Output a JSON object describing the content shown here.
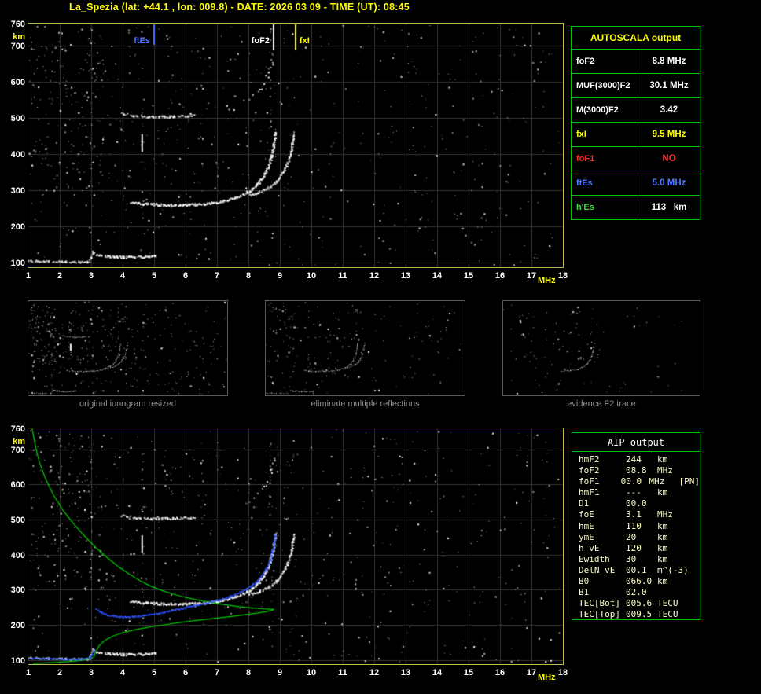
{
  "title": "La_Spezia (lat: +44.1 , lon: 009.8) - DATE: 2026 03 09 - TIME (UT): 08:45",
  "colors": {
    "yellow": "#ffff00",
    "white": "#ffffff",
    "green": "#00c400",
    "blue": "#4d79ff",
    "red": "#ff2828",
    "grid": "#333333",
    "plot_border": "#b9b94f",
    "thumb_border": "#5a5a5a",
    "caption": "#909090",
    "aip_text": "#ffffc8",
    "profile": "#00d800",
    "trace_blue": "#2e52ff"
  },
  "axes": {
    "y_ticks": [
      760,
      700,
      600,
      500,
      400,
      300,
      200,
      100
    ],
    "y_unit": "km",
    "x_ticks": [
      1,
      2,
      3,
      4,
      5,
      6,
      7,
      8,
      9,
      10,
      11,
      12,
      13,
      14,
      15,
      16,
      17,
      18
    ],
    "x_unit": "MHz",
    "x_range_mhz": [
      1,
      18
    ],
    "y_range_km": [
      88,
      760
    ]
  },
  "markers": [
    {
      "label": "ftEs",
      "freq": 5.0,
      "color": "#4d79ff",
      "side": "left",
      "line_length": 26
    },
    {
      "label": "foF2",
      "freq": 8.8,
      "color": "#ffffff",
      "side": "left",
      "line_length": 33
    },
    {
      "label": "fxI",
      "freq": 9.5,
      "color": "#ffff00",
      "side": "right",
      "line_length": 33
    }
  ],
  "autoscala_table": {
    "title": "AUTOSCALA output",
    "rows": [
      {
        "label": "foF2",
        "value": "8.8 MHz",
        "label_color": "#ffffff",
        "value_color": "#ffffff"
      },
      {
        "label": "MUF(3000)F2",
        "value": "30.1 MHz",
        "label_color": "#ffffff",
        "value_color": "#ffffff"
      },
      {
        "label": "M(3000)F2",
        "value": "3.42",
        "label_color": "#ffffff",
        "value_color": "#ffffff"
      },
      {
        "label": "fxI",
        "value": "9.5 MHz",
        "label_color": "#ffff00",
        "value_color": "#ffff00"
      },
      {
        "label": "foF1",
        "value": "NO",
        "label_color": "#ff2828",
        "value_color": "#ff2828"
      },
      {
        "label": "ftEs",
        "value": "5.0 MHz",
        "label_color": "#4d79ff",
        "value_color": "#4d79ff"
      },
      {
        "label": "h'Es",
        "value": "113   km",
        "label_color": "#3fdd3f",
        "value_color": "#ffffff"
      }
    ]
  },
  "aip_table": {
    "title": "AIP output",
    "rows": [
      {
        "name": "hmF2",
        "value": "244",
        "unit": "km"
      },
      {
        "name": "foF2",
        "value": "08.8",
        "unit": "MHz"
      },
      {
        "name": "foF1",
        "value": "00.0",
        "unit": "MHz",
        "extra": "[PN]"
      },
      {
        "name": "hmF1",
        "value": "---",
        "unit": "km"
      },
      {
        "name": "D1",
        "value": "00.0",
        "unit": ""
      },
      {
        "name": "foE",
        "value": "3.1",
        "unit": "MHz"
      },
      {
        "name": "hmE",
        "value": "110",
        "unit": "km"
      },
      {
        "name": "ymE",
        "value": "20",
        "unit": "km"
      },
      {
        "name": "h_vE",
        "value": "120",
        "unit": "km"
      },
      {
        "name": "Ewidth",
        "value": "30",
        "unit": "km"
      },
      {
        "name": "DelN_vE",
        "value": "00.1",
        "unit": "m^(-3)"
      },
      {
        "name": "B0",
        "value": "066.0",
        "unit": "km"
      },
      {
        "name": "B1",
        "value": "02.0",
        "unit": ""
      },
      {
        "name": "TEC[Bot]",
        "value": "005.6",
        "unit": "TECU"
      },
      {
        "name": "TEC[Top]",
        "value": "009.5",
        "unit": "TECU"
      }
    ]
  },
  "thumbnails": [
    {
      "caption": "original ionogram resized"
    },
    {
      "caption": "eliminate multiple reflections"
    },
    {
      "caption": "evidence F2 trace"
    }
  ],
  "chart_data": {
    "type": "scatter",
    "description": "Vertical-incidence ionogram: virtual height (km) vs sounding frequency (MHz), with Autoscala scaled parameters and AIP electron-density profile overlay",
    "x_range_mhz": [
      1,
      18
    ],
    "y_range_km": [
      88,
      760
    ],
    "scaled_values": {
      "foF2_MHz": 8.8,
      "MUF3000F2_MHz": 30.1,
      "M3000F2": 3.42,
      "fxI_MHz": 9.5,
      "foF1": null,
      "ftEs_MHz": 5.0,
      "hEs_km": 113,
      "hmF2_km": 244
    },
    "traces": {
      "e_layer": [
        [
          1.0,
          108
        ],
        [
          1.5,
          106
        ],
        [
          2.2,
          105
        ],
        [
          2.9,
          104
        ]
      ],
      "e_hook": [
        [
          2.92,
          104
        ],
        [
          2.98,
          114
        ],
        [
          3.03,
          126
        ],
        [
          3.06,
          134
        ]
      ],
      "es_layer": [
        [
          3.1,
          126
        ],
        [
          3.5,
          120
        ],
        [
          4.0,
          117
        ],
        [
          4.5,
          118
        ],
        [
          4.85,
          120
        ],
        [
          5.05,
          122
        ]
      ],
      "f_trace": [
        [
          4.25,
          268
        ],
        [
          4.7,
          264
        ],
        [
          5.3,
          261
        ],
        [
          6.0,
          261
        ],
        [
          6.6,
          264
        ],
        [
          7.1,
          270
        ],
        [
          7.55,
          280
        ],
        [
          7.95,
          295
        ],
        [
          8.25,
          315
        ],
        [
          8.45,
          338
        ],
        [
          8.6,
          362
        ],
        [
          8.7,
          390
        ],
        [
          8.78,
          422
        ],
        [
          8.83,
          452
        ],
        [
          8.85,
          462
        ]
      ],
      "x_trace": [
        [
          8.0,
          288
        ],
        [
          8.35,
          297
        ],
        [
          8.65,
          310
        ],
        [
          8.9,
          328
        ],
        [
          9.1,
          352
        ],
        [
          9.25,
          382
        ],
        [
          9.35,
          415
        ],
        [
          9.41,
          445
        ],
        [
          9.44,
          460
        ]
      ],
      "f_hop2": [
        [
          3.95,
          514
        ],
        [
          4.3,
          508
        ],
        [
          4.9,
          504
        ],
        [
          5.6,
          505
        ],
        [
          6.25,
          508
        ]
      ],
      "f_hop2_rise": [
        [
          7.9,
          545
        ],
        [
          8.25,
          572
        ],
        [
          8.5,
          602
        ],
        [
          8.68,
          640
        ],
        [
          8.78,
          678
        ]
      ],
      "f2_only": [
        [
          6.0,
          264
        ],
        [
          6.8,
          267
        ],
        [
          7.4,
          275
        ],
        [
          7.9,
          292
        ],
        [
          8.2,
          312
        ],
        [
          8.45,
          338
        ],
        [
          8.6,
          365
        ],
        [
          8.7,
          395
        ],
        [
          8.78,
          428
        ],
        [
          8.83,
          458
        ]
      ],
      "x_partial": [
        [
          8.9,
          330
        ],
        [
          9.1,
          360
        ],
        [
          9.25,
          395
        ],
        [
          9.35,
          435
        ]
      ]
    },
    "artifact_column": {
      "f": 4.62,
      "h": [
        405,
        455
      ]
    },
    "noise": {
      "uniform": 520,
      "left_band": 130,
      "mid_band": 120,
      "big": 0.3,
      "columns": [
        {
          "f": 4.62,
          "count": 22,
          "h": [
            140,
            760
          ]
        },
        {
          "f": 8.68,
          "count": 14,
          "h": [
            470,
            760
          ]
        },
        {
          "f": 2.98,
          "count": 10,
          "h": [
            140,
            700
          ]
        },
        {
          "f": 6.5,
          "count": 8,
          "h": [
            300,
            740
          ]
        },
        {
          "f": 5.55,
          "count": 6,
          "h": [
            540,
            700
          ]
        }
      ]
    },
    "profile": [
      [
        1.12,
        760
      ],
      [
        1.22,
        712
      ],
      [
        1.35,
        664
      ],
      [
        1.55,
        616
      ],
      [
        1.8,
        570
      ],
      [
        2.1,
        527
      ],
      [
        2.45,
        487
      ],
      [
        2.8,
        452
      ],
      [
        3.15,
        420
      ],
      [
        3.5,
        392
      ],
      [
        3.85,
        367
      ],
      [
        4.2,
        345
      ],
      [
        4.55,
        326
      ],
      [
        4.9,
        310
      ],
      [
        5.3,
        296
      ],
      [
        5.75,
        284
      ],
      [
        6.2,
        274
      ],
      [
        6.7,
        265
      ],
      [
        7.2,
        258
      ],
      [
        7.7,
        252
      ],
      [
        8.15,
        248
      ],
      [
        8.5,
        245.5
      ],
      [
        8.72,
        244.4
      ],
      [
        8.8,
        244
      ],
      [
        8.78,
        242
      ],
      [
        8.6,
        238.5
      ],
      [
        8.3,
        234
      ],
      [
        7.9,
        229
      ],
      [
        7.45,
        224
      ],
      [
        6.95,
        219
      ],
      [
        6.4,
        213
      ],
      [
        5.85,
        207
      ],
      [
        5.3,
        200
      ],
      [
        4.8,
        193
      ],
      [
        4.35,
        185
      ],
      [
        3.98,
        177
      ],
      [
        3.7,
        168
      ],
      [
        3.5,
        159
      ],
      [
        3.36,
        150
      ],
      [
        3.26,
        141
      ],
      [
        3.2,
        132
      ],
      [
        3.15,
        124
      ],
      [
        3.11,
        116
      ],
      [
        3.1,
        110
      ],
      [
        3.02,
        105
      ],
      [
        2.85,
        101
      ],
      [
        2.6,
        98
      ],
      [
        2.25,
        95
      ],
      [
        1.85,
        93
      ],
      [
        1.45,
        91
      ],
      [
        1.15,
        90
      ]
    ],
    "fitted": [
      [
        3.15,
        246
      ],
      [
        3.3,
        237
      ],
      [
        3.5,
        230
      ],
      [
        3.75,
        226
      ],
      [
        4.05,
        224
      ],
      [
        4.35,
        225
      ],
      [
        4.65,
        228
      ],
      [
        4.95,
        232
      ],
      [
        5.3,
        238
      ],
      [
        5.65,
        244
      ],
      [
        6.0,
        251
      ],
      [
        6.35,
        258
      ],
      [
        6.7,
        265
      ],
      [
        7.05,
        273
      ],
      [
        7.4,
        283
      ],
      [
        7.7,
        294
      ],
      [
        7.95,
        306
      ],
      [
        8.2,
        322
      ],
      [
        8.4,
        341
      ],
      [
        8.55,
        362
      ],
      [
        8.67,
        387
      ],
      [
        8.75,
        413
      ],
      [
        8.8,
        438
      ],
      [
        8.84,
        460
      ]
    ],
    "e_blue": [
      [
        1.0,
        106
      ],
      [
        1.5,
        105
      ],
      [
        2.1,
        104
      ],
      [
        2.6,
        104
      ],
      [
        2.92,
        106
      ],
      [
        3.0,
        116
      ],
      [
        3.05,
        128
      ]
    ]
  }
}
